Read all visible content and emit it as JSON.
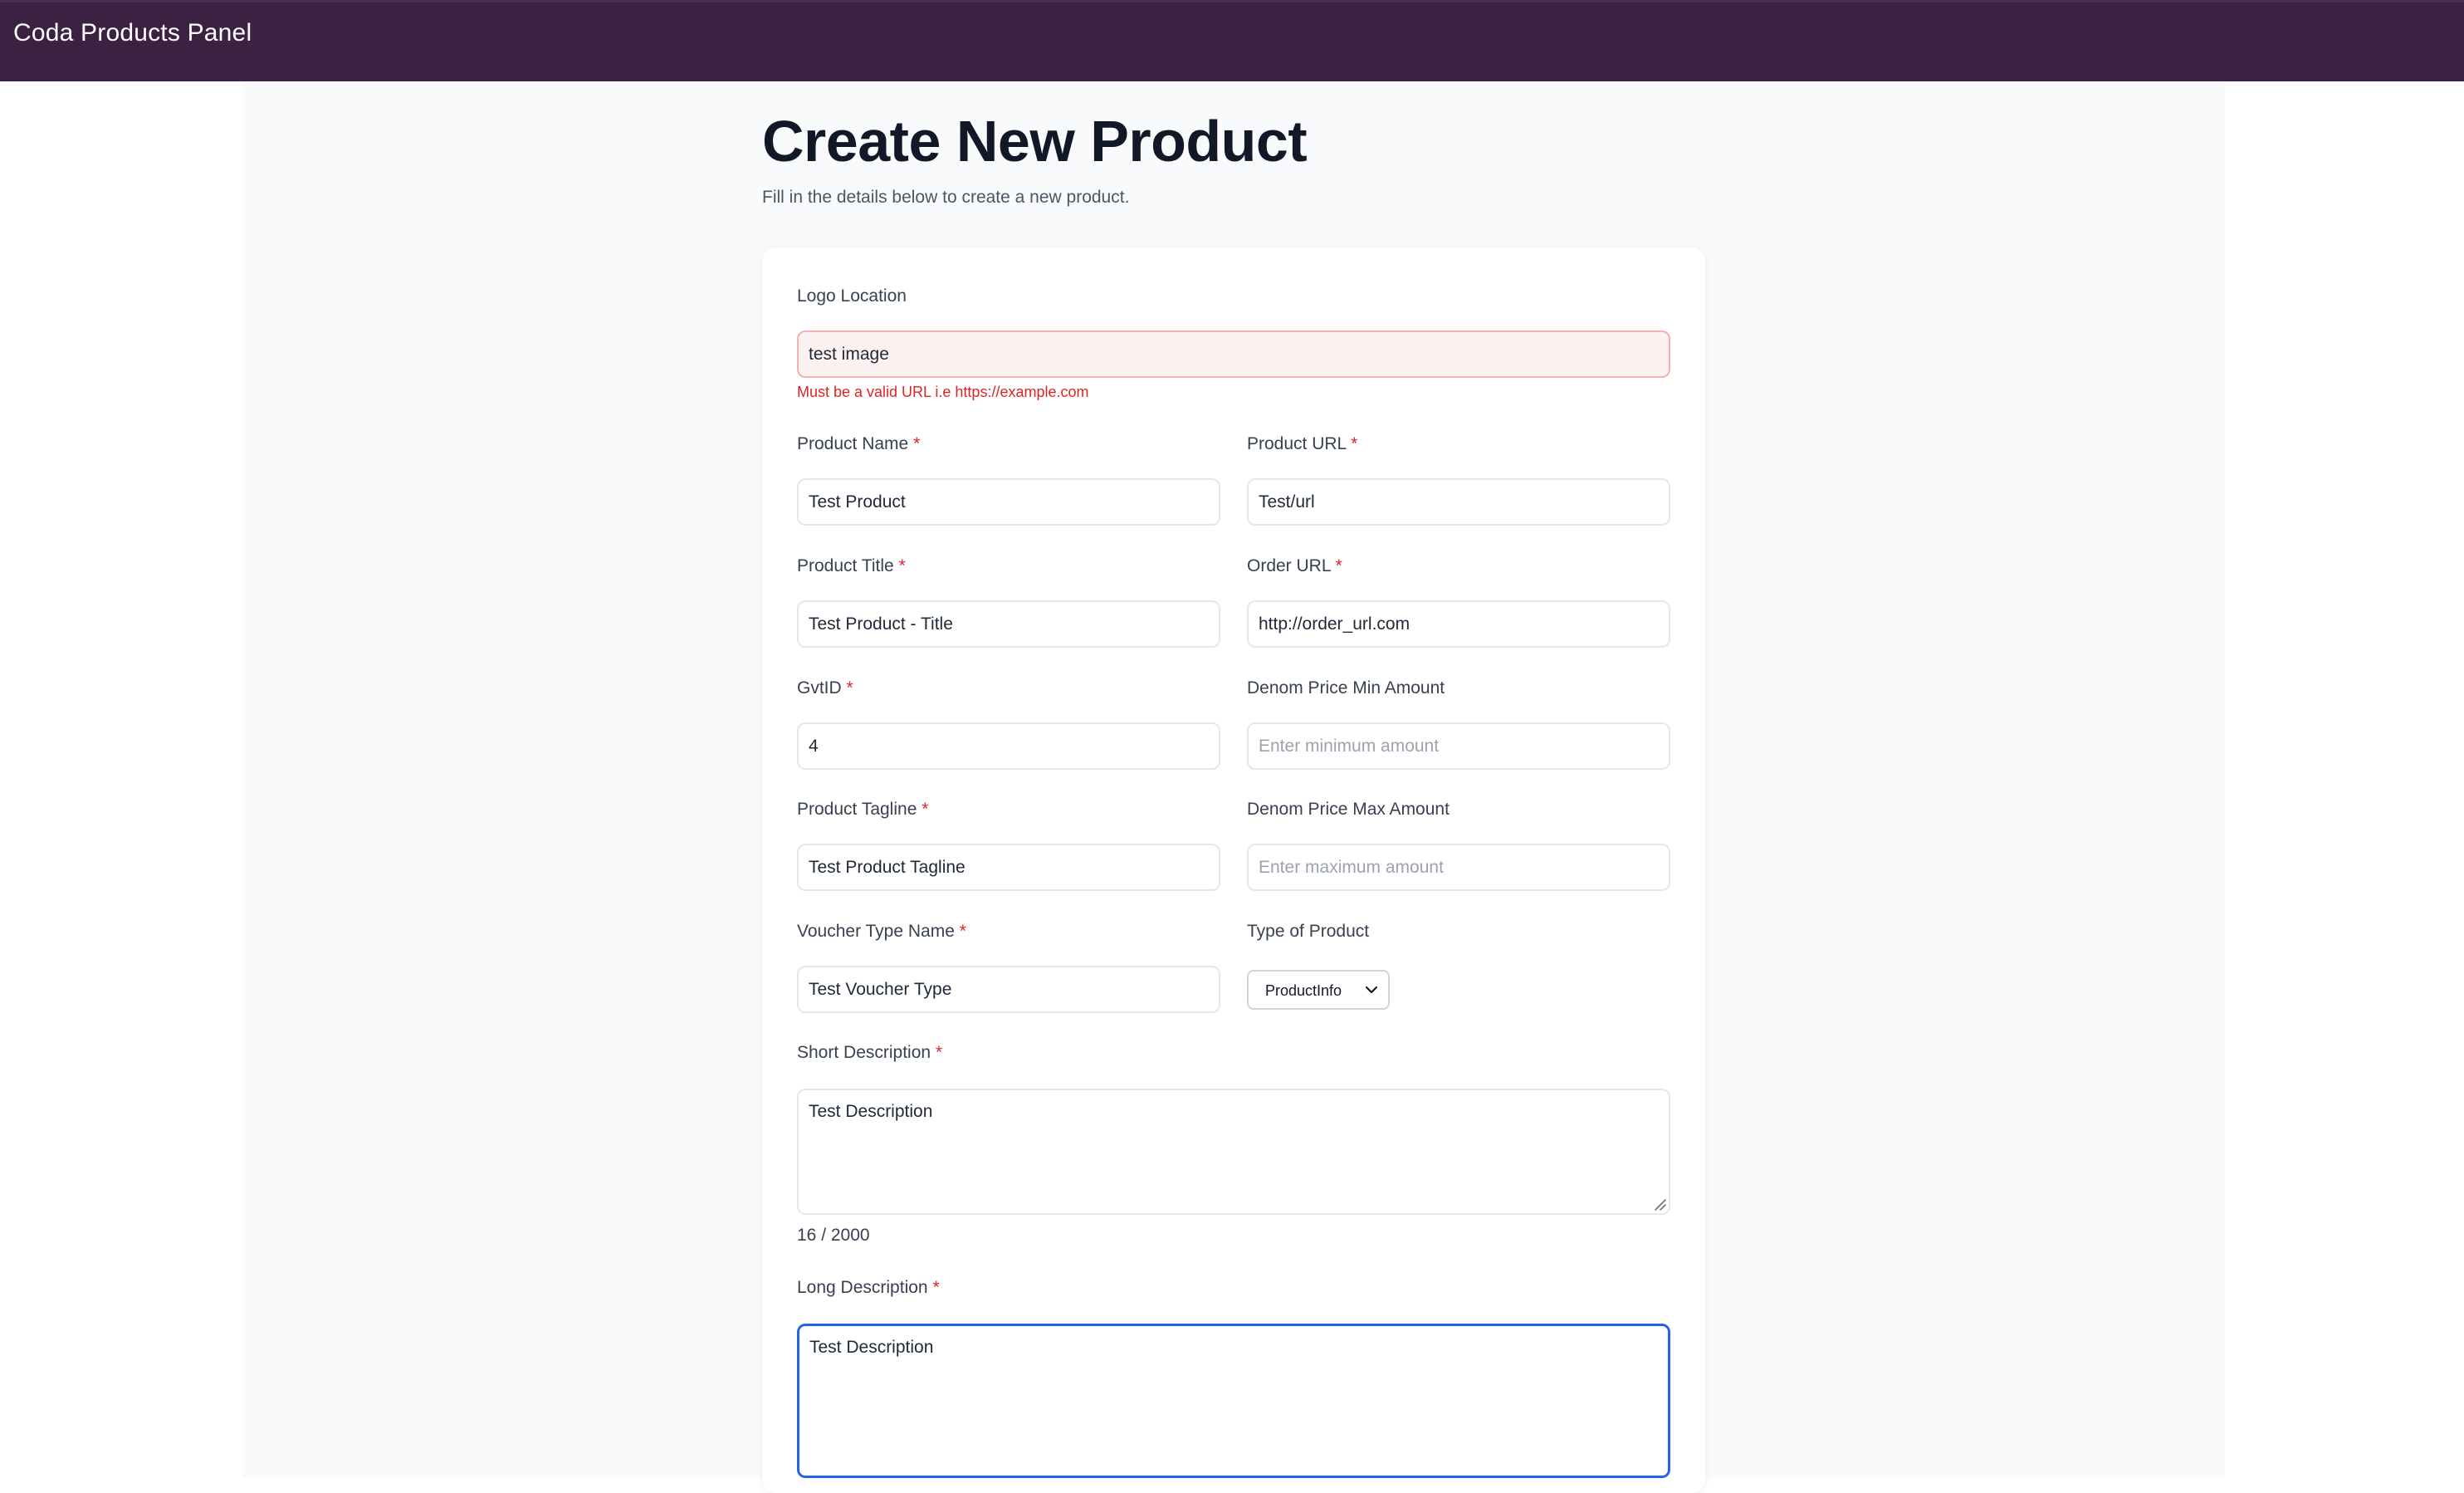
{
  "app": {
    "title": "Coda Products Panel"
  },
  "page": {
    "title": "Create New Product",
    "subtitle": "Fill in the details below to create a new product."
  },
  "form": {
    "logo_location": {
      "label": "Logo Location",
      "value": "test image",
      "error": "Must be a valid URL i.e https://example.com"
    },
    "product_name": {
      "label": "Product Name",
      "required": "*",
      "value": "Test Product"
    },
    "product_url": {
      "label": "Product URL",
      "required": "*",
      "value": "Test/url"
    },
    "product_title": {
      "label": "Product Title",
      "required": "*",
      "value": "Test Product - Title"
    },
    "order_url": {
      "label": "Order URL",
      "required": "*",
      "value": "http://order_url.com"
    },
    "gvtid": {
      "label": "GvtID",
      "required": "*",
      "value": "4"
    },
    "denom_min": {
      "label": "Denom Price Min Amount",
      "value": "",
      "placeholder": "Enter minimum amount"
    },
    "product_tagline": {
      "label": "Product Tagline",
      "required": "*",
      "value": "Test Product Tagline"
    },
    "denom_max": {
      "label": "Denom Price Max Amount",
      "value": "",
      "placeholder": "Enter maximum amount"
    },
    "voucher_type": {
      "label": "Voucher Type Name",
      "required": "*",
      "value": "Test Voucher Type"
    },
    "product_type": {
      "label": "Type of Product",
      "selected": "ProductInfo"
    },
    "short_description": {
      "label": "Short Description",
      "required": "*",
      "value": "Test Description",
      "counter": "16 / 2000"
    },
    "long_description": {
      "label": "Long Description",
      "required": "*",
      "value": "Test Description"
    }
  },
  "icons": {
    "select_chevron": "chevron-down-icon",
    "resize_grip": "resize-grip-icon"
  },
  "colors": {
    "topbar": "#3b2142",
    "required": "#dc2626",
    "error_bg": "#fdf2f2",
    "focus": "#2563eb"
  }
}
